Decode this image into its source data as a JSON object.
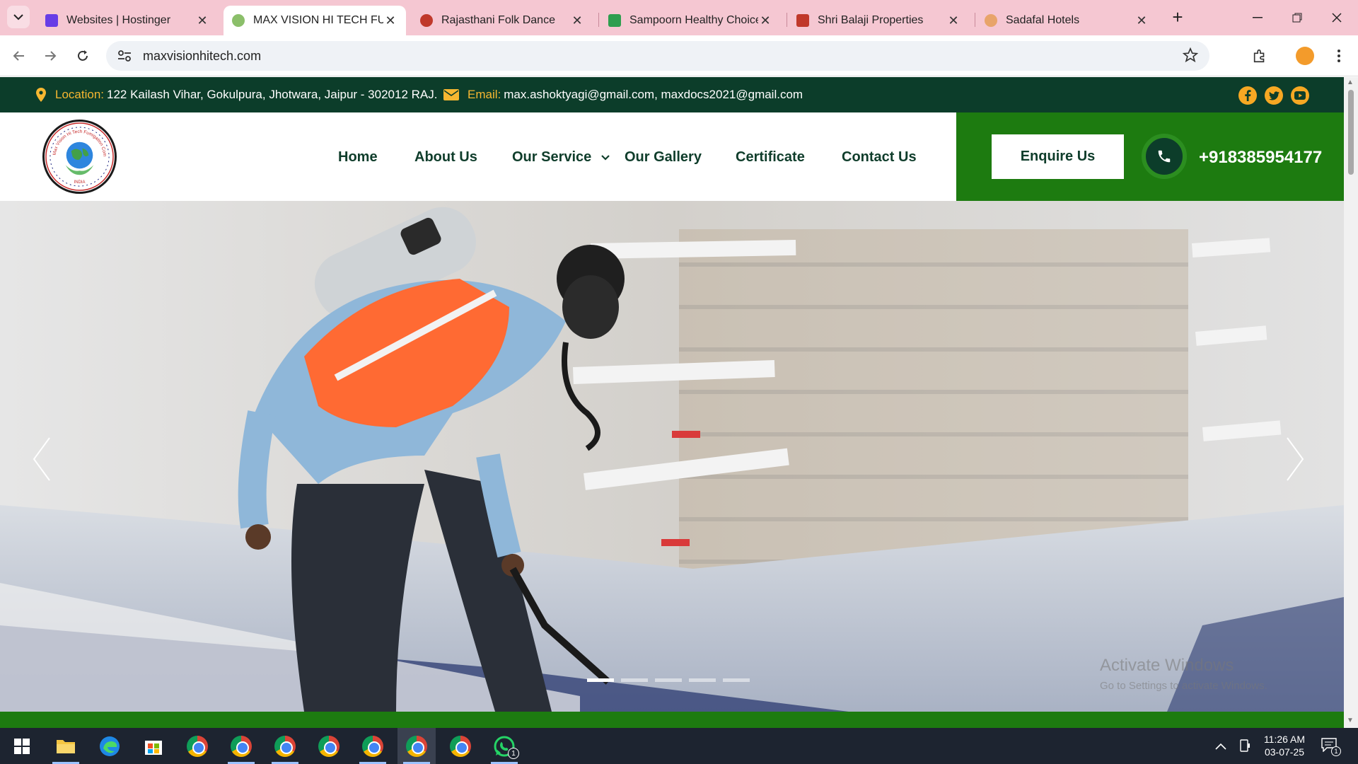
{
  "browser": {
    "tabs": [
      {
        "title": "Websites | Hostinger",
        "favicon_color": "#673de6",
        "active": false
      },
      {
        "title": "MAX VISION HI TECH FUMIGATION",
        "favicon_color": "#8bbf6a",
        "active": true
      },
      {
        "title": "Rajasthani Folk Dance",
        "favicon_color": "#c0392b",
        "active": false
      },
      {
        "title": "Sampoorn Healthy Choice",
        "favicon_color": "#2e9e4f",
        "active": false
      },
      {
        "title": "Shri Balaji Properties",
        "favicon_color": "#c0392b",
        "active": false
      },
      {
        "title": "Sadafal Hotels",
        "favicon_color": "#e8a46a",
        "active": false
      }
    ],
    "url": "maxvisionhitech.com"
  },
  "topbar": {
    "location_label": "Location:",
    "location_value": "122 Kailash Vihar, Gokulpura, Jhotwara, Jaipur - 302012 RAJ.",
    "email_label": "Email:",
    "email_value": "max.ashoktyagi@gmail.com,  maxdocs2021@gmail.com",
    "social_icons": [
      "facebook-icon",
      "twitter-icon",
      "youtube-icon"
    ]
  },
  "header": {
    "logo_text": "Max Vision Hi Tech Fumigation Company",
    "logo_subtext": "INDIA",
    "nav": {
      "home": "Home",
      "about": "About Us",
      "service": "Our Service",
      "gallery": "Our Gallery",
      "certificate": "Certificate",
      "contact": "Contact Us"
    },
    "enquire_label": "Enquire Us",
    "phone": "+918385954177"
  },
  "hero": {
    "slide_count": 5,
    "active_slide": 1
  },
  "watermark": {
    "line1": "Activate Windows",
    "line2": "Go to Settings to activate Windows."
  },
  "taskbar": {
    "time": "11:26 AM",
    "date": "03-07-25",
    "notification_count": "1",
    "whatsapp_badge": "1"
  },
  "colors": {
    "topbar_bg": "#0c3d2a",
    "accent_green": "#1d7b10",
    "label_yellow": "#f7b731",
    "tabbar_bg": "#f5c7d2"
  }
}
